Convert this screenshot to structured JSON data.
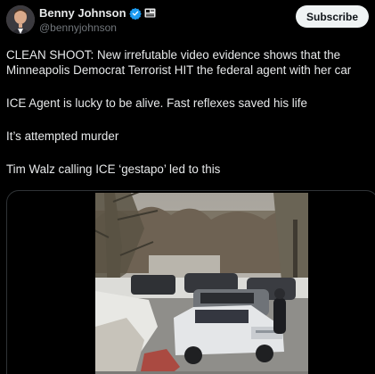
{
  "author": {
    "display_name": "Benny Johnson",
    "handle": "@bennyjohnson",
    "verified_icon": "verified-badge-icon",
    "affiliation_icon": "affiliate-badge-icon",
    "verified_color": "#1d9bf0"
  },
  "actions": {
    "subscribe_label": "Subscribe"
  },
  "tweet": {
    "paragraphs": [
      "CLEAN SHOOT: New irrefutable video evidence shows that the Minneapolis Democrat Terrorist HIT the federal agent with her car",
      "ICE Agent is lucky to be alive. Fast reflexes saved his life",
      "It’s attempted murder",
      "Tim Walz calling ICE ‘gestapo’ led to this"
    ]
  },
  "media": {
    "type": "video",
    "description_icon": "video-thumbnail"
  },
  "colors": {
    "background": "#000000",
    "text": "#e7e9ea",
    "secondary_text": "#71767b",
    "button_bg": "#eff3f4",
    "button_text": "#0f1419",
    "border": "#2f3336"
  }
}
